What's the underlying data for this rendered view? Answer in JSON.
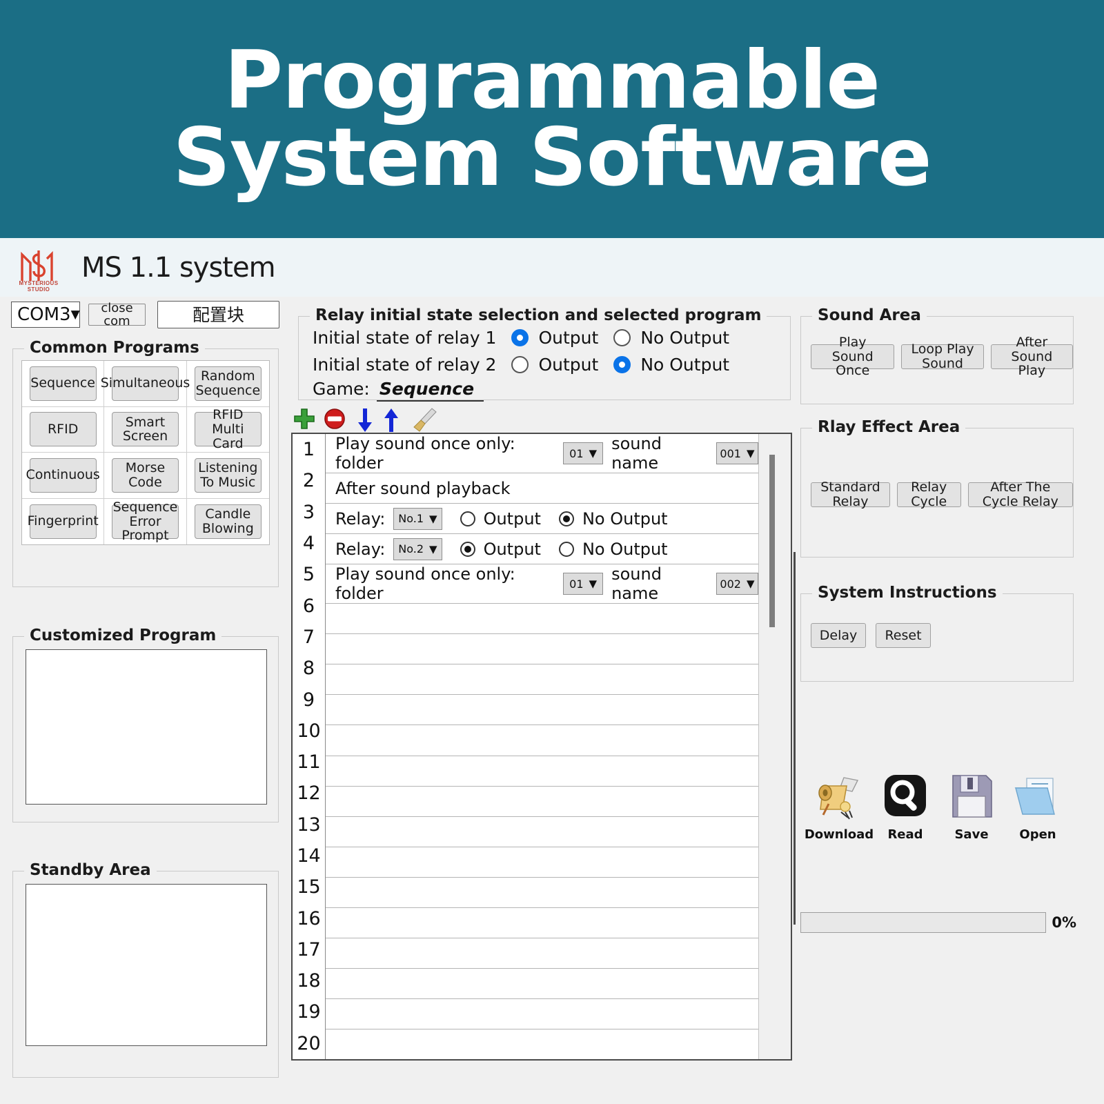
{
  "banner": {
    "line1": "Programmable",
    "line2": "System Software",
    "bg_color": "#1b6e85"
  },
  "titlebar": {
    "app_title": "MS 1.1 system",
    "logo_caption": "MYSTERIOUS STUDIO"
  },
  "connection": {
    "port_selected": "COM3",
    "close_com_label": "close com",
    "config_block_label": "配置块"
  },
  "common_programs": {
    "legend": "Common Programs",
    "buttons": [
      "Sequence",
      "Simultaneous",
      "Random\nSequence",
      "RFID",
      "Smart\nScreen",
      "RFID\nMulti Card",
      "Continuous",
      "Morse Code",
      "Listening\nTo Music",
      "Fingerprint",
      "Sequence\nError Prompt",
      "Candle\nBlowing"
    ]
  },
  "customized_program": {
    "legend": "Customized Program",
    "content": ""
  },
  "standby_area": {
    "legend": "Standby Area",
    "content": ""
  },
  "relay_panel": {
    "legend": "Relay initial state selection and selected program",
    "relay1_label": "Initial state of relay 1",
    "relay1_output_label": "Output",
    "relay1_nooutput_label": "No Output",
    "relay1_selected": "Output",
    "relay2_label": "Initial state of relay 2",
    "relay2_output_label": "Output",
    "relay2_nooutput_label": "No Output",
    "relay2_selected": "No Output",
    "game_label": "Game:",
    "game_value": "Sequence"
  },
  "toolbar": {
    "add_icon": "plus-icon",
    "delete_icon": "minus-circle-icon",
    "move_down_icon": "arrow-down-icon",
    "move_up_icon": "arrow-up-icon",
    "clear_icon": "broom-icon"
  },
  "program_list": {
    "row_numbers": [
      "1",
      "2",
      "3",
      "4",
      "5",
      "6",
      "7",
      "8",
      "9",
      "10",
      "11",
      "12",
      "13",
      "14",
      "15",
      "16",
      "17",
      "18",
      "19",
      "20"
    ],
    "rows": [
      {
        "index": "1",
        "type": "play-sound-once",
        "text_before": "Play sound once only: folder",
        "folder_value": "01",
        "text_middle": "sound name",
        "sound_value": "001"
      },
      {
        "index": "2",
        "type": "after-sound-playback",
        "text": "After sound playback"
      },
      {
        "index": "3",
        "type": "relay",
        "label": "Relay:",
        "relay_value": "No.1",
        "output_label": "Output",
        "nooutput_label": "No Output",
        "selected": "No Output"
      },
      {
        "index": "4",
        "type": "relay",
        "label": "Relay:",
        "relay_value": "No.2",
        "output_label": "Output",
        "nooutput_label": "No Output",
        "selected": "Output"
      },
      {
        "index": "5",
        "type": "play-sound-once",
        "text_before": "Play sound once only: folder",
        "folder_value": "01",
        "text_middle": "sound name",
        "sound_value": "002"
      }
    ]
  },
  "sound_area": {
    "legend": "Sound Area",
    "buttons": [
      "Play Sound Once",
      "Loop Play Sound",
      "After Sound Play"
    ]
  },
  "rlay_effect_area": {
    "legend": "Rlay Effect Area",
    "buttons": [
      "Standard Relay",
      "Relay Cycle",
      "After The Cycle Relay"
    ]
  },
  "system_instructions": {
    "legend": "System Instructions",
    "buttons": [
      "Delay",
      "Reset"
    ]
  },
  "file_actions": [
    {
      "label": "Download",
      "icon": "scroll-quill-icon"
    },
    {
      "label": "Read",
      "icon": "magnifier-icon"
    },
    {
      "label": "Save",
      "icon": "floppy-disk-icon"
    },
    {
      "label": "Open",
      "icon": "open-folder-icon"
    }
  ],
  "progress": {
    "percent_label": "0%",
    "value": 0
  }
}
